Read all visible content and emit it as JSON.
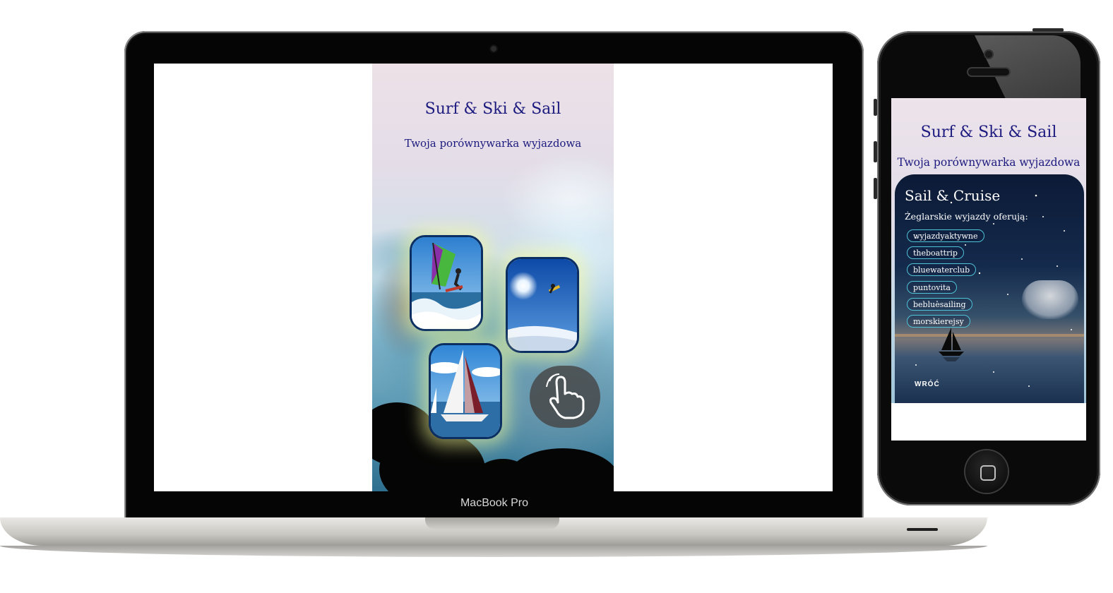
{
  "laptop": {
    "brand_label": "MacBook Pro",
    "app": {
      "title": "Surf & Ski & Sail",
      "subtitle": "Twoja porównywarka wyjazdowa",
      "cards": [
        {
          "name": "windsurf",
          "icon": "windsurfing-photo"
        },
        {
          "name": "ski",
          "icon": "ski-jump-photo"
        },
        {
          "name": "sail",
          "icon": "sailboat-photo"
        }
      ],
      "hand_icon": "pointing-hand-icon"
    }
  },
  "phone": {
    "app": {
      "title": "Surf & Ski & Sail",
      "subtitle": "Twoja porównywarka wyjazdowa",
      "section_title": "Sail & Cruise",
      "section_subtitle": "Żeglarskie wyjazdy oferują:",
      "providers": [
        "wyjazdyaktywne",
        "theboattrip",
        "bluewaterclub",
        "puntovita",
        "bebluesailing",
        "morskierejsy"
      ],
      "back_label": "WRÓĆ"
    }
  },
  "colors": {
    "title": "#1c1a7e",
    "card_border": "#0c2f63",
    "pill_border": "#4fc2d6"
  }
}
